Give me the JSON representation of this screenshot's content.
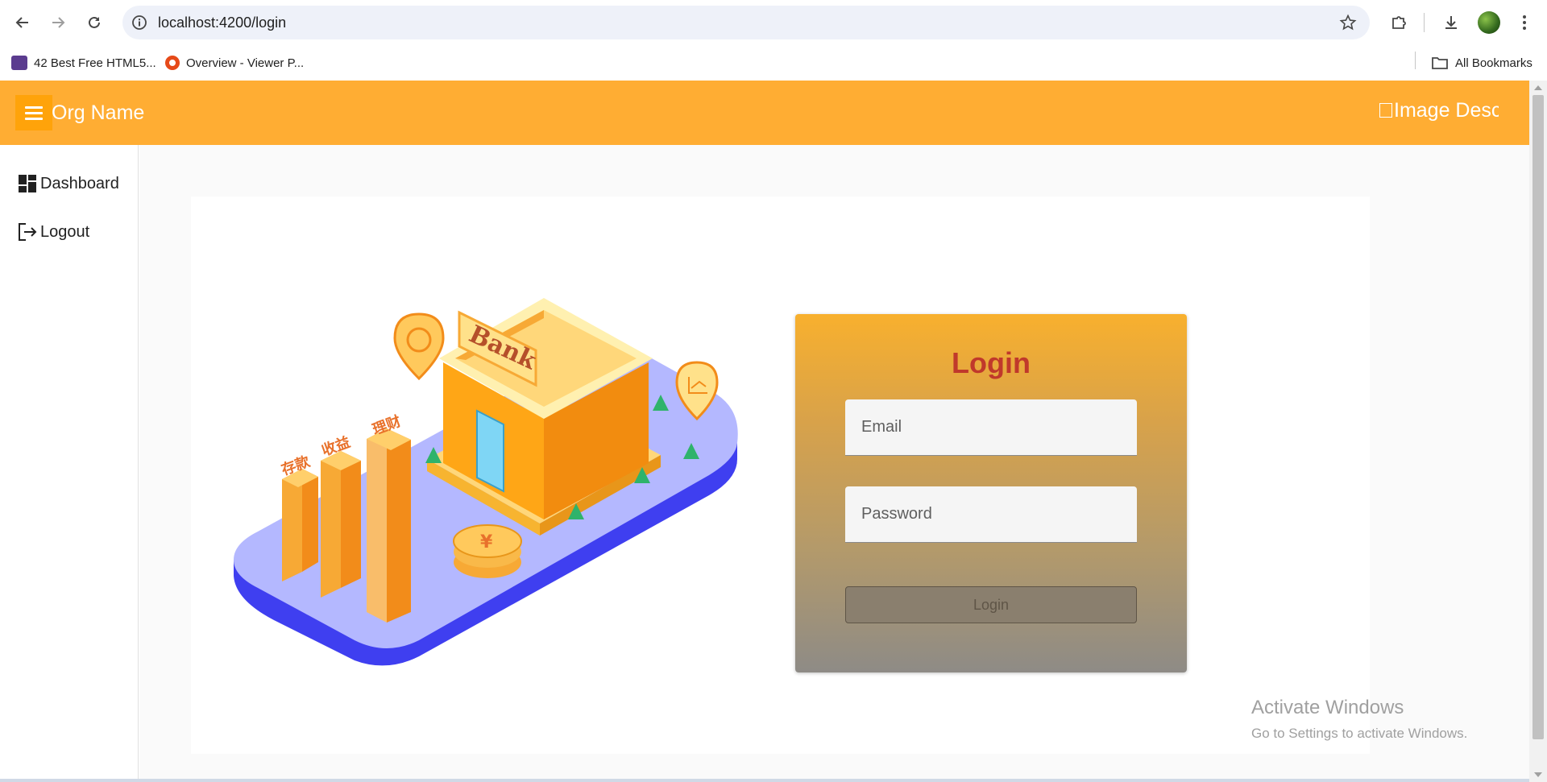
{
  "browser": {
    "url": "localhost:4200/login",
    "bookmarks": [
      {
        "label": "42 Best Free HTML5...",
        "icon": "colorlib-icon"
      },
      {
        "label": "Overview - Viewer P...",
        "icon": "viewer-icon"
      }
    ],
    "all_bookmarks_label": "All Bookmarks"
  },
  "app": {
    "org_name": "Org Name",
    "logo_alt": "Image Desc",
    "accent_color": "#ffad33"
  },
  "sidebar": {
    "items": [
      {
        "label": "Dashboard",
        "icon": "dashboard-icon"
      },
      {
        "label": "Logout",
        "icon": "logout-icon"
      }
    ]
  },
  "illustration": {
    "sign_text": "Bank",
    "bar_labels": [
      "存款",
      "收益",
      "理财"
    ],
    "coin_symbol": "¥"
  },
  "login": {
    "title": "Login",
    "email_placeholder": "Email",
    "password_placeholder": "Password",
    "button_label": "Login"
  },
  "watermark": {
    "line1": "Activate Windows",
    "line2": "Go to Settings to activate Windows."
  }
}
